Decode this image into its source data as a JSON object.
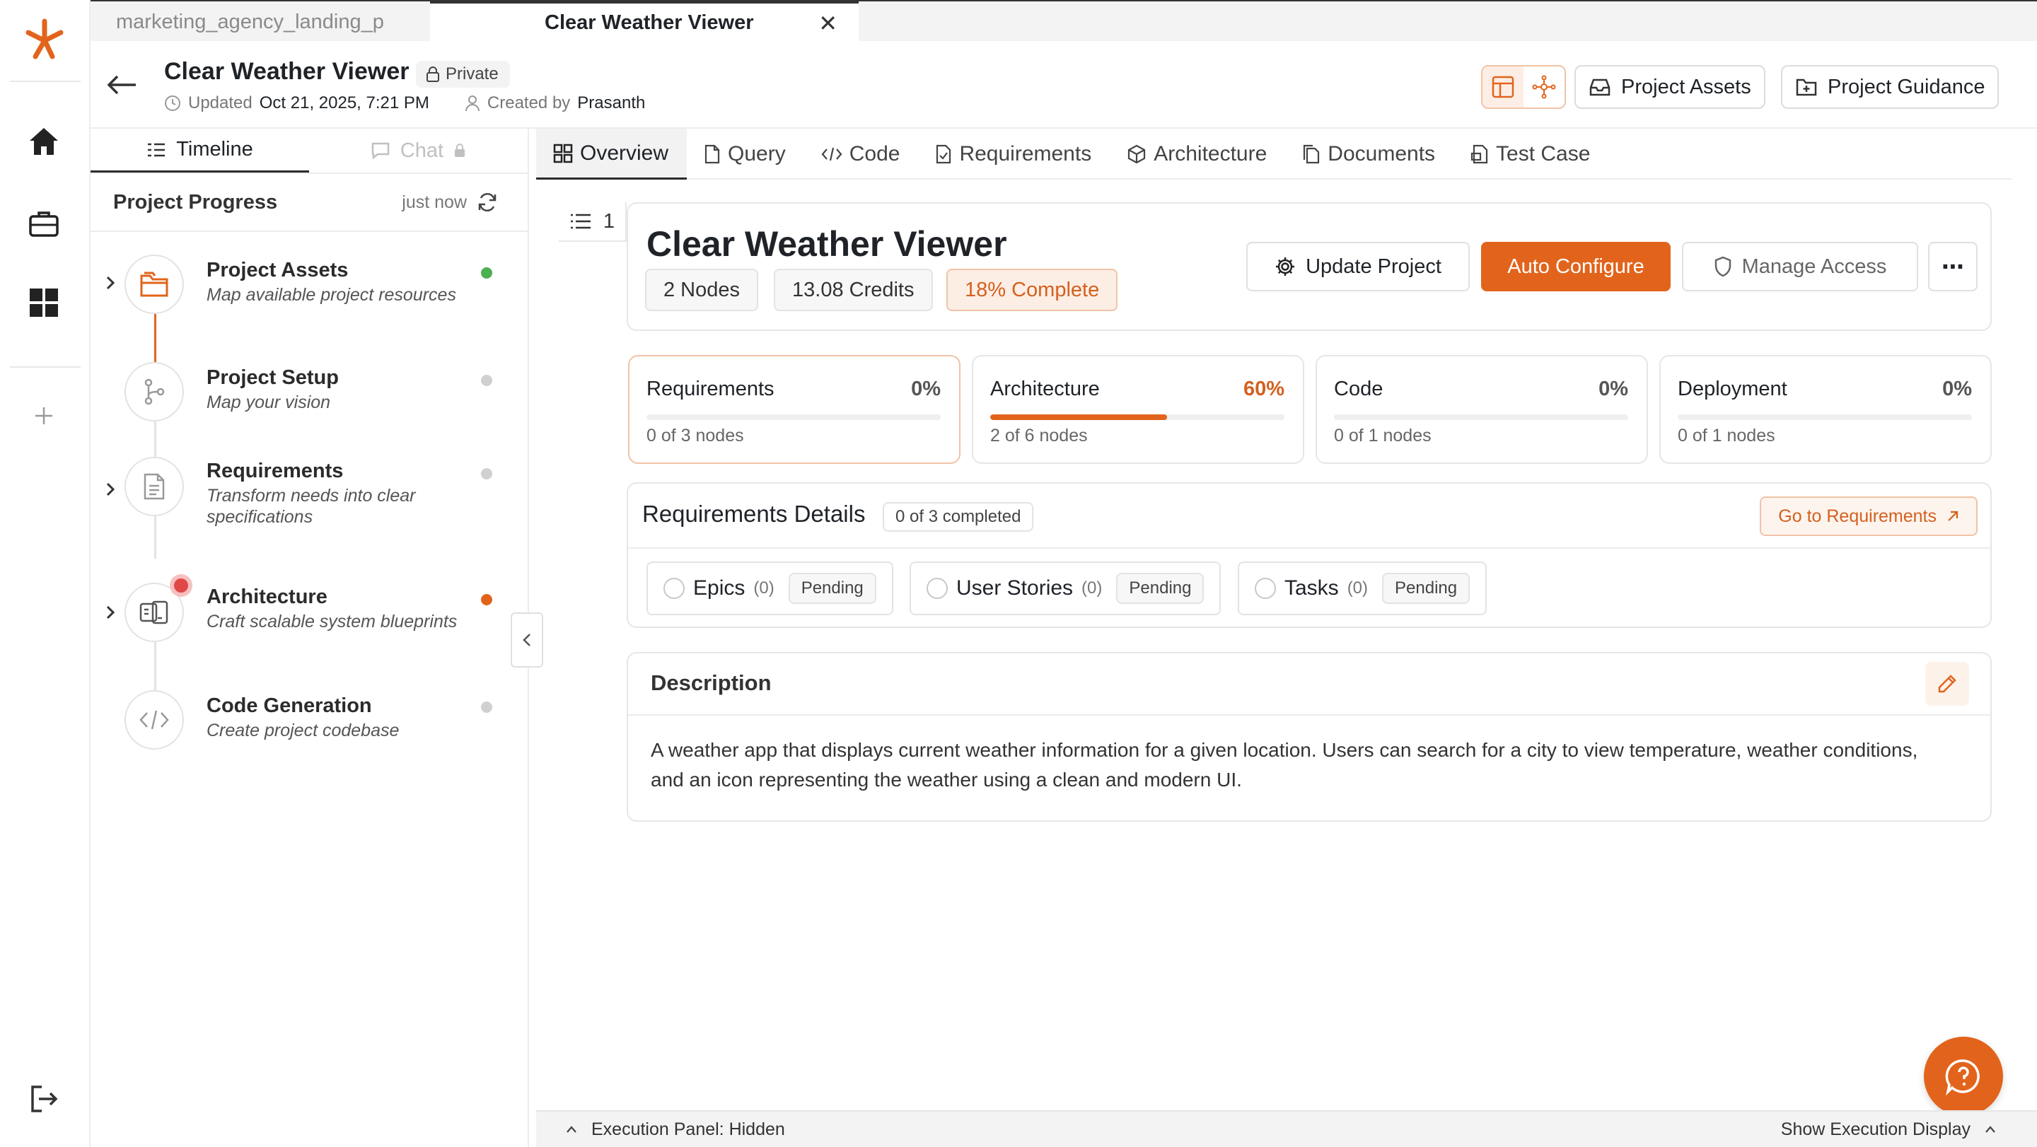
{
  "file_tabs": [
    {
      "label": "marketing_agency_landing_p"
    },
    {
      "label": "Clear Weather Viewer",
      "close": "✕"
    }
  ],
  "header": {
    "title": "Clear Weather Viewer",
    "privacy": "Private",
    "updated_label": "Updated",
    "updated_value": "Oct 21, 2025, 7:21 PM",
    "created_label": "Created by",
    "created_value": "Prasanth",
    "project_assets_button": "Project Assets",
    "project_guidance_button": "Project Guidance"
  },
  "left_tabs": {
    "timeline": "Timeline",
    "chat": "Chat"
  },
  "progress": {
    "title": "Project Progress",
    "updated": "just now",
    "steps": [
      {
        "name": "Project Assets",
        "desc": "Map available project resources",
        "status_color": "#4caf50"
      },
      {
        "name": "Project Setup",
        "desc": "Map your vision",
        "status_color": "#d0d0d0"
      },
      {
        "name": "Requirements",
        "desc": "Transform needs into clear specifications",
        "status_color": "#d0d0d0"
      },
      {
        "name": "Architecture",
        "desc": "Craft scalable system blueprints",
        "status_color": "#e2641c"
      },
      {
        "name": "Code Generation",
        "desc": "Create project codebase",
        "status_color": "#d0d0d0"
      }
    ]
  },
  "main_tabs": [
    "Overview",
    "Query",
    "Code",
    "Requirements",
    "Architecture",
    "Documents",
    "Test Case"
  ],
  "outline_count": "1",
  "overview": {
    "title": "Clear Weather Viewer",
    "nodes": "2 Nodes",
    "credits": "13.08 Credits",
    "complete": "18% Complete",
    "update_button": "Update Project",
    "auto_button": "Auto Configure",
    "manage_button": "Manage Access",
    "more": "⋯"
  },
  "phases": [
    {
      "name": "Requirements",
      "percent": "0%",
      "progress": 0,
      "count": "0 of 3 nodes"
    },
    {
      "name": "Architecture",
      "percent": "60%",
      "progress": 0.6,
      "count": "2 of 6 nodes"
    },
    {
      "name": "Code",
      "percent": "0%",
      "progress": 0,
      "count": "0 of 1 nodes"
    },
    {
      "name": "Deployment",
      "percent": "0%",
      "progress": 0,
      "count": "0 of 1 nodes"
    }
  ],
  "requirements": {
    "title": "Requirements Details",
    "count": "0 of 3 completed",
    "goto": "Go to Requirements",
    "items": [
      {
        "label": "Epics",
        "count": "(0)",
        "status": "Pending"
      },
      {
        "label": "User Stories",
        "count": "(0)",
        "status": "Pending"
      },
      {
        "label": "Tasks",
        "count": "(0)",
        "status": "Pending"
      }
    ]
  },
  "description": {
    "title": "Description",
    "text": "A weather app that displays current weather information for a given location. Users can search for a city to view temperature, weather conditions, and an icon representing the weather using a clean and modern UI."
  },
  "footer": {
    "left": "Execution Panel: Hidden",
    "right": "Show Execution Display"
  },
  "colors": {
    "accent": "#e2641c",
    "accent_light": "#fdeee5"
  }
}
